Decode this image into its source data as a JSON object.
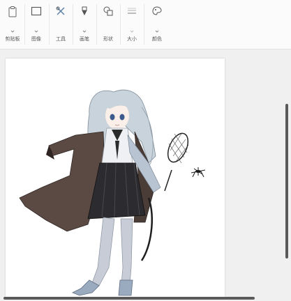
{
  "toolbar": {
    "clipboard_label": "剪贴板",
    "image_label": "图像",
    "tools_label": "工具",
    "brushes_label": "画笔",
    "shapes_label": "形状",
    "size_label": "大小",
    "colors_label": "颜色"
  },
  "colors": {
    "ribbon_bg": "#fbfbfb",
    "workspace_bg": "#f0f0f0",
    "canvas_bg": "#ffffff",
    "scrollbar": "#5a5a5a"
  }
}
